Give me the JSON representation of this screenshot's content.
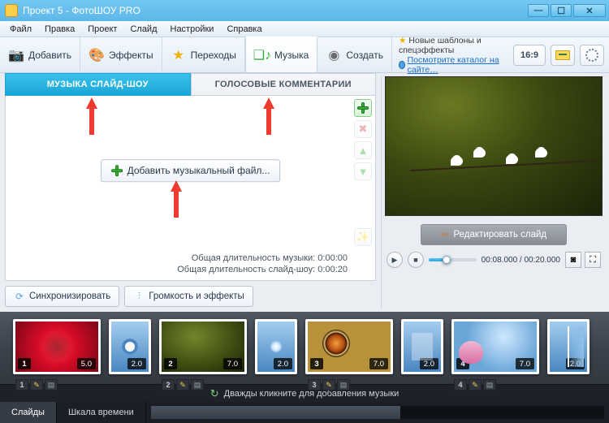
{
  "window": {
    "title": "Проект 5 - ФотоШОУ PRO"
  },
  "menu": {
    "file": "Файл",
    "edit": "Правка",
    "project": "Проект",
    "slide": "Слайд",
    "settings": "Настройки",
    "help": "Справка"
  },
  "toolbar": {
    "add": "Добавить",
    "effects": "Эффекты",
    "transitions": "Переходы",
    "music": "Музыка",
    "create": "Создать",
    "promo_line": "Новые шаблоны и спецэффекты",
    "promo_link": "Посмотрите каталог на сайте…",
    "aspect": "16:9"
  },
  "tabs": {
    "music": "МУЗЫКА СЛАЙД-ШОУ",
    "voice": "ГОЛОСОВЫЕ КОММЕНТАРИИ"
  },
  "music": {
    "add_file_btn": "Добавить музыкальный файл...",
    "total_music_label": "Общая длительность музыки:",
    "total_music_value": "0:00:00",
    "total_show_label": "Общая длительность слайд-шоу:",
    "total_show_value": "0:00:20",
    "sync_btn": "Синхронизировать",
    "volume_btn": "Громкость и эффекты"
  },
  "preview": {
    "edit_btn": "Редактировать слайд",
    "time_current": "00:08.000",
    "time_total": "00:20.000"
  },
  "timeline": {
    "slides": [
      {
        "num": "1",
        "dur": "5.0",
        "trans": "2.0"
      },
      {
        "num": "2",
        "dur": "7.0",
        "trans": "2.0"
      },
      {
        "num": "3",
        "dur": "7.0",
        "trans": "2.0"
      },
      {
        "num": "4",
        "dur": "7.0",
        "trans": "2.0"
      }
    ],
    "music_hint": "Дважды кликните для добавления музыки"
  },
  "footer": {
    "slides": "Слайды",
    "scale": "Шкала времени"
  }
}
